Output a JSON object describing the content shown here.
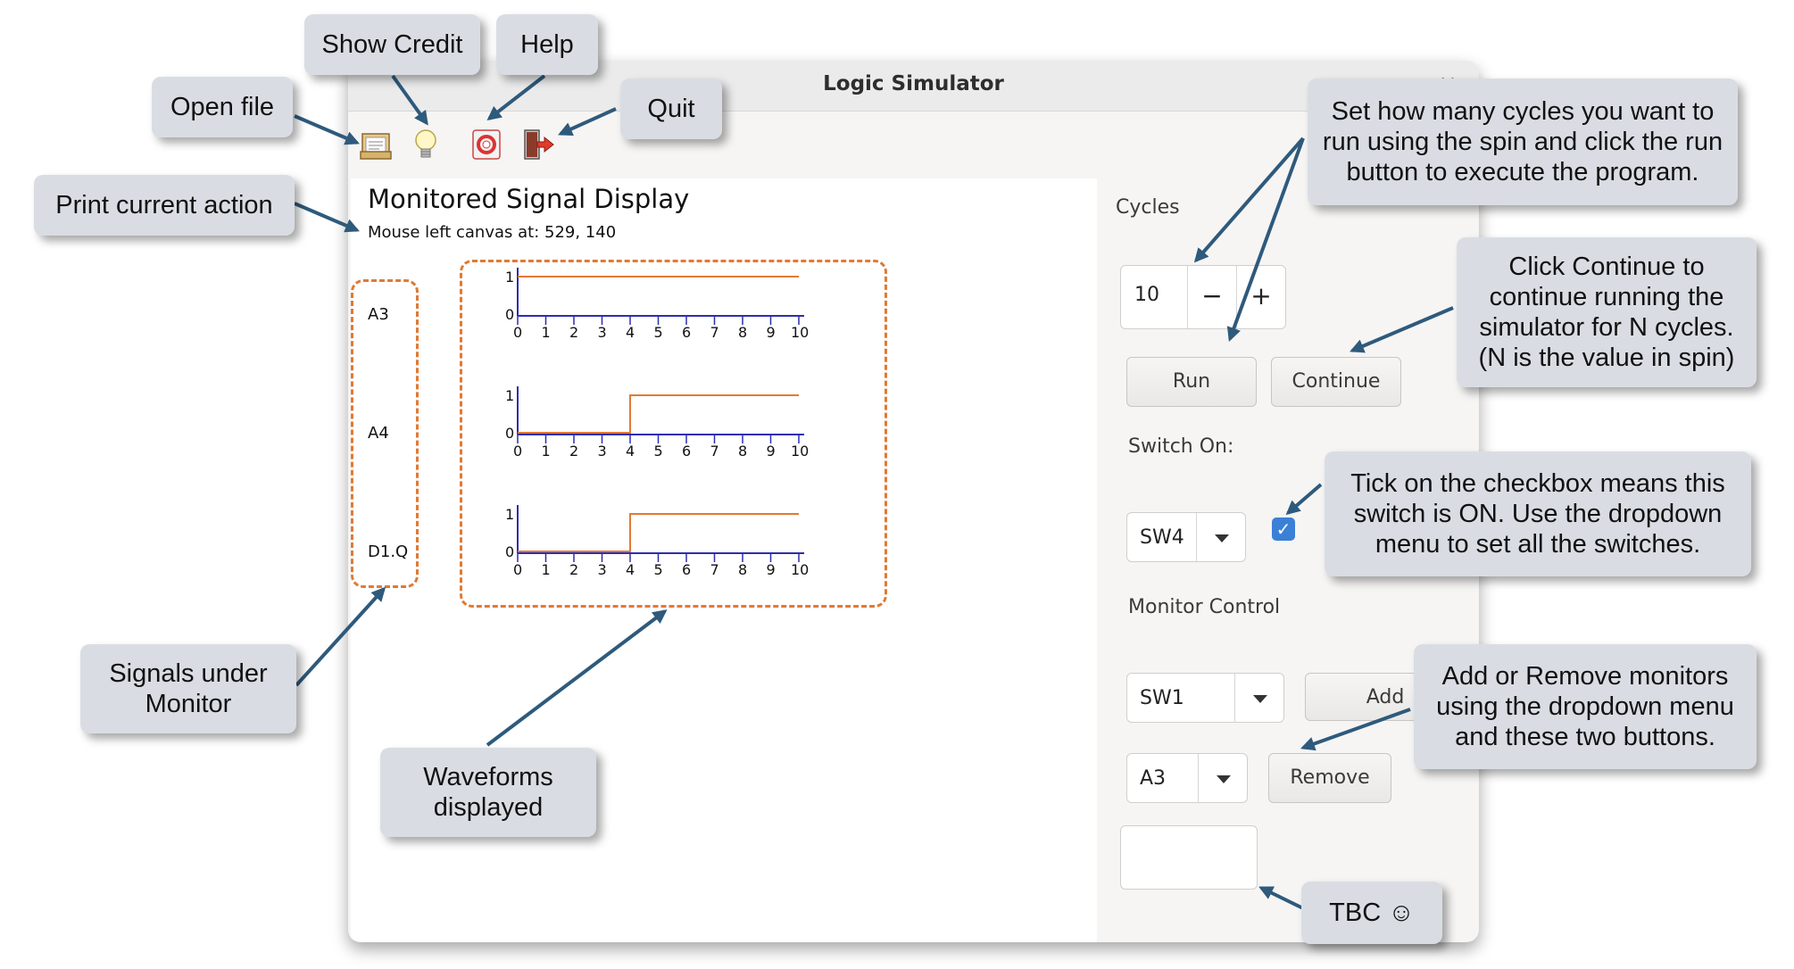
{
  "window": {
    "title": "Logic Simulator",
    "close_glyph": "×"
  },
  "toolbar": {
    "open": "open-file-icon",
    "credit": "lightbulb-icon",
    "help": "help-lifebuoy-icon",
    "quit": "quit-exit-icon"
  },
  "canvas": {
    "title": "Monitored Signal Display",
    "status": "Mouse left canvas at: 529, 140",
    "signals": [
      "A3",
      "A4",
      "D1.Q"
    ]
  },
  "chart_data": {
    "type": "line",
    "x_ticks": [
      "0",
      "1",
      "2",
      "3",
      "4",
      "5",
      "6",
      "7",
      "8",
      "9",
      "10"
    ],
    "y_ticks": [
      "0",
      "1"
    ],
    "series": [
      {
        "name": "A3",
        "values": [
          1,
          1,
          1,
          1,
          1,
          1,
          1,
          1,
          1,
          1
        ]
      },
      {
        "name": "A4",
        "values": [
          0,
          0,
          0,
          0,
          1,
          1,
          1,
          1,
          1,
          1
        ]
      },
      {
        "name": "D1.Q",
        "values": [
          0,
          0,
          0,
          0,
          1,
          1,
          1,
          1,
          1,
          1
        ]
      }
    ],
    "wave_color": "#e07a35",
    "axis_color": "#2d2db0"
  },
  "side": {
    "cycles_label": "Cycles",
    "cycles_value": "10",
    "minus": "−",
    "plus": "+",
    "run": "Run",
    "continue": "Continue",
    "switch_label": "Switch On:",
    "switch_selected": "SW4",
    "switch_checked": "✓",
    "monitor_label": "Monitor Control",
    "add_selected": "SW1",
    "add_button": "Add",
    "remove_selected": "A3",
    "remove_button": "Remove"
  },
  "callouts": {
    "show_credit": "Show Credit",
    "help": "Help",
    "open_file": "Open file",
    "quit": "Quit",
    "print_action": "Print current action",
    "cycles_help": "Set how many cycles you want to run using the spin and click the run button to execute the program.",
    "continue_help": "Click Continue to continue running the simulator for N cycles. (N is the value in spin)",
    "checkbox_help": "Tick on the checkbox means this switch is ON. Use the dropdown menu to set all the switches.",
    "monitors_help": "Add or Remove monitors using the dropdown menu and these two buttons.",
    "signals_help": "Signals under Monitor",
    "waveforms_help": "Waveforms displayed",
    "tbc": "TBC ☺"
  },
  "colors": {
    "callout_bg": "#d9dde3",
    "arrow": "#2e5a7c",
    "dash": "#e07a35",
    "check": "#3b80d6"
  }
}
